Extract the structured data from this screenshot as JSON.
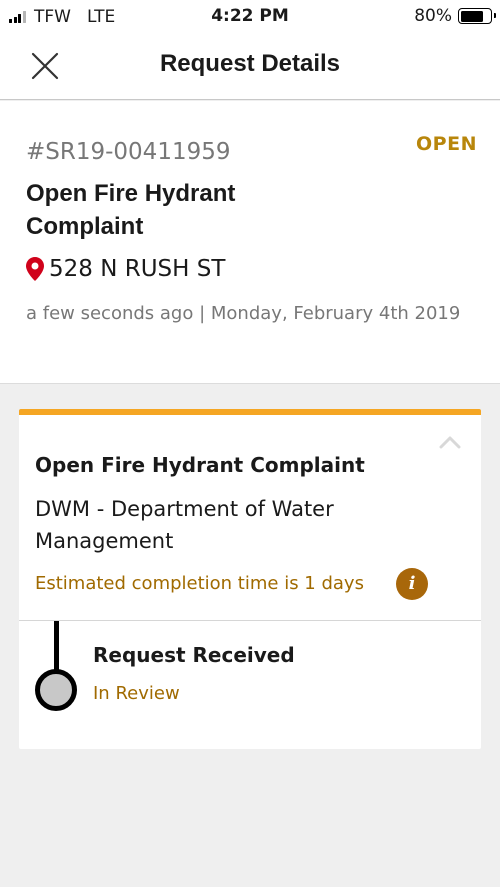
{
  "status_bar": {
    "carrier": "TFW",
    "network": "LTE",
    "time": "4:22 PM",
    "battery": "80%",
    "battery_level": 0.8
  },
  "nav": {
    "title": "Request Details",
    "close_icon": "close-icon"
  },
  "request": {
    "id": "#SR19-00411959",
    "status": "OPEN",
    "title": "Open Fire Hydrant Complaint",
    "address": "528 N RUSH ST",
    "time": "a few seconds ago | Monday, February 4th 2019"
  },
  "card": {
    "title": "Open Fire Hydrant Complaint",
    "department": "DWM - Department of Water Management",
    "estimate": "Estimated completion time is 1 days",
    "info_icon_glyph": "i",
    "timeline": [
      {
        "title": "Request Received",
        "status": "In Review"
      }
    ]
  },
  "colors": {
    "accent": "#f5a623",
    "status_text": "#b8860b",
    "info_text": "#a06a00",
    "pin": "#d0021b",
    "page_background": "#efefef"
  }
}
